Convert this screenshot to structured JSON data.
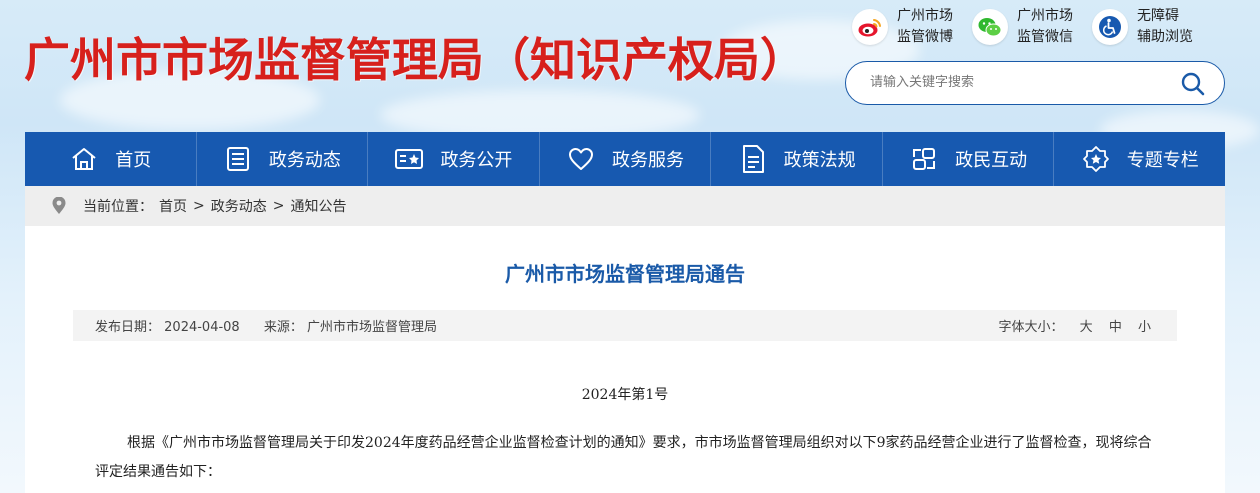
{
  "header": {
    "site_title": "广州市市场监督管理局（知识产权局）",
    "quick_links": [
      {
        "line1": "广州市场",
        "line2": "监管微博",
        "icon": "weibo-icon"
      },
      {
        "line1": "广州市场",
        "line2": "监管微信",
        "icon": "wechat-icon"
      },
      {
        "line1": "无障碍",
        "line2": "辅助浏览",
        "icon": "accessibility-icon"
      }
    ],
    "search": {
      "placeholder": "请输入关键字搜索",
      "value": ""
    }
  },
  "nav": {
    "items": [
      {
        "label": "首页",
        "icon": "home-icon"
      },
      {
        "label": "政务动态",
        "icon": "news-icon"
      },
      {
        "label": "政务公开",
        "icon": "open-gov-icon"
      },
      {
        "label": "政务服务",
        "icon": "heart-icon"
      },
      {
        "label": "政策法规",
        "icon": "document-icon"
      },
      {
        "label": "政民互动",
        "icon": "interaction-icon"
      },
      {
        "label": "专题专栏",
        "icon": "star-badge-icon"
      }
    ]
  },
  "breadcrumb": {
    "prefix": "当前位置：",
    "items": [
      "首页",
      "政务动态",
      "通知公告"
    ],
    "separator": ">"
  },
  "article": {
    "title": "广州市市场监督管理局通告",
    "publish_label": "发布日期：",
    "publish_date": "2024-04-08",
    "source_label": "来源：",
    "source": "广州市市场监督管理局",
    "font_size_label": "字体大小：",
    "font_sizes": [
      "大",
      "中",
      "小"
    ],
    "doc_number": "2024年第1号",
    "paragraph": "根据《广州市市场监督管理局关于印发2024年度药品经营企业监督检查计划的通知》要求，市市场监督管理局组织对以下9家药品经营企业进行了监督检查，现将综合评定结果通告如下："
  },
  "colors": {
    "brand_red": "#d7201c",
    "nav_blue": "#1759b0",
    "title_blue": "#1a5aa8"
  }
}
